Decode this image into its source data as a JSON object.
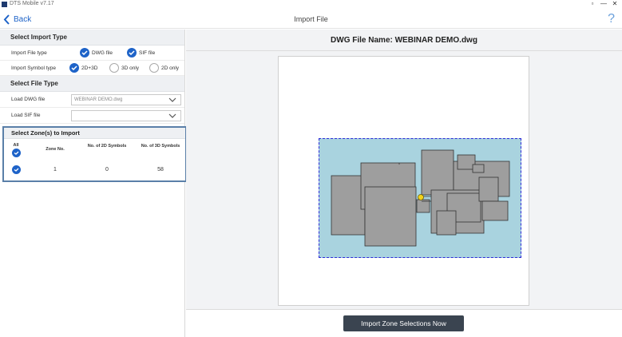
{
  "window": {
    "title": "DTS Mobile v7.17",
    "controls": [
      "▫",
      "—",
      "✕"
    ]
  },
  "topbar": {
    "back_label": "Back",
    "title": "Import File",
    "help_label": "?"
  },
  "left_panel": {
    "import_type": {
      "heading": "Select Import Type",
      "file_type_label": "Import File type",
      "file_type_options": [
        "DWG file",
        "SIF file"
      ],
      "symbol_type_label": "Import Symbol type",
      "symbol_type_options": [
        "2D+3D",
        "3D only",
        "2D only"
      ],
      "symbol_type_selected": "2D+3D"
    },
    "file_type": {
      "heading": "Select File Type",
      "dwg_label": "Load DWG file",
      "dwg_value": "WEBINAR DEMO.dwg",
      "sif_label": "Load SIF file",
      "sif_value": ""
    },
    "zones": {
      "heading": "Select Zone(s) to Import",
      "col_all": "All",
      "col_zone": "Zone No.",
      "col_2d": "No. of 2D Symbols",
      "col_3d": "No. of 3D Symbols",
      "rows": [
        {
          "zone": "1",
          "symbols_2d": "0",
          "symbols_3d": "58",
          "checked": true
        }
      ]
    }
  },
  "main": {
    "file_name_label": "DWG File Name: WEBINAR DEMO.dwg",
    "import_button": "Import Zone Selections Now"
  },
  "colors": {
    "accent": "#1e63c8",
    "plan_background": "#a9d3df",
    "plan_border": "#2c2ad8",
    "building": "#9e9e9e",
    "button": "#3a4450"
  }
}
